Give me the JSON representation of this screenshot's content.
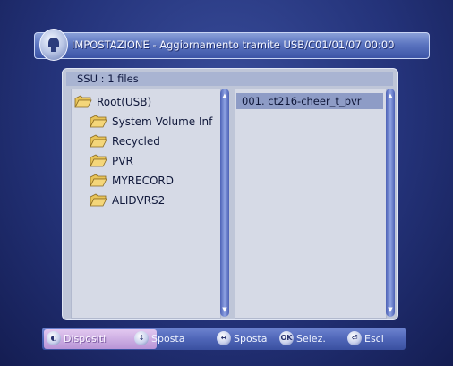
{
  "header": {
    "title": "IMPOSTAZIONE - Aggiornamento tramite USB/C01/01/07 00:00"
  },
  "panel": {
    "header_label": "SSU :   1 files"
  },
  "tree": {
    "items": [
      {
        "label": "Root(USB)"
      },
      {
        "label": "System Volume Inf"
      },
      {
        "label": "Recycled"
      },
      {
        "label": "PVR"
      },
      {
        "label": "MYRECORD"
      },
      {
        "label": "ALIDVRS2"
      }
    ]
  },
  "files": {
    "items": [
      {
        "label": "001.  ct216-cheer_t_pvr"
      }
    ]
  },
  "bottom": {
    "items": [
      {
        "label": "Dispositi",
        "icon": "dev-icon"
      },
      {
        "label": "Sposta",
        "icon": "updown-icon"
      },
      {
        "label": "Sposta",
        "icon": "leftright-icon"
      },
      {
        "label": "Selez.",
        "icon": "ok-icon"
      },
      {
        "label": "Esci",
        "icon": "exit-icon"
      }
    ]
  },
  "colors": {
    "accent": "#4f66b8",
    "panel": "#bfc6d8",
    "selection": "#8e9cc6"
  }
}
